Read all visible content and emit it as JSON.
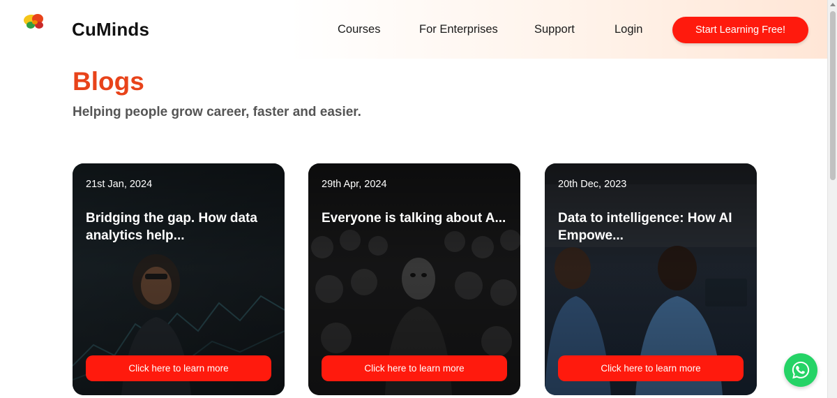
{
  "header": {
    "brand": "CuMinds",
    "nav": [
      "Courses",
      "For Enterprises",
      "Support",
      "Login"
    ],
    "cta_label": "Start Learning Free!"
  },
  "hero": {
    "title": "Blogs",
    "subtitle": "Helping people grow career, faster and easier."
  },
  "cards": [
    {
      "date": "21st Jan, 2024",
      "title": "Bridging the gap. How data analytics help...",
      "button": "Click here to learn more"
    },
    {
      "date": "29th Apr, 2024",
      "title": "Everyone is talking about A...",
      "button": "Click here to learn more"
    },
    {
      "date": "20th Dec, 2023",
      "title": "Data to intelligence: How AI Empowe...",
      "button": "Click here to learn more"
    }
  ],
  "colors": {
    "accent": "#ff1a0d",
    "title_orange": "#e8431a",
    "whatsapp_green": "#25d366"
  },
  "icons": {
    "logo": "cuminds-brain-logo-icon",
    "whatsapp": "whatsapp-icon"
  }
}
